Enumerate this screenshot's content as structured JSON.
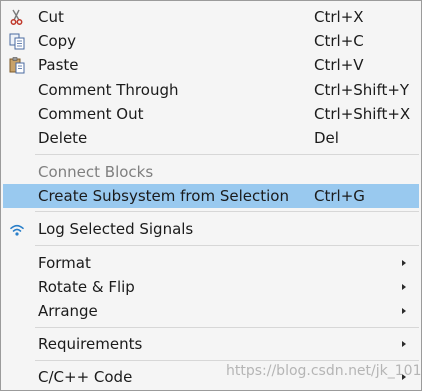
{
  "menu": {
    "items": [
      {
        "label": "Cut",
        "shortcut": "Ctrl+X",
        "icon": "scissors-icon"
      },
      {
        "label": "Copy",
        "shortcut": "Ctrl+C",
        "icon": "copy-icon"
      },
      {
        "label": "Paste",
        "shortcut": "Ctrl+V",
        "icon": "paste-icon"
      },
      {
        "label": "Comment Through",
        "shortcut": "Ctrl+Shift+Y"
      },
      {
        "label": "Comment Out",
        "shortcut": "Ctrl+Shift+X"
      },
      {
        "label": "Delete",
        "shortcut": "Del"
      },
      {
        "label": "Connect Blocks",
        "disabled": true
      },
      {
        "label": "Create Subsystem from Selection",
        "shortcut": "Ctrl+G",
        "highlighted": true
      },
      {
        "label": "Log Selected Signals",
        "icon": "wifi-signal-icon"
      },
      {
        "label": "Format",
        "submenu": true
      },
      {
        "label": "Rotate & Flip",
        "submenu": true
      },
      {
        "label": "Arrange",
        "submenu": true
      },
      {
        "label": "Requirements",
        "submenu": true
      },
      {
        "label": "C/C++ Code",
        "submenu": true
      }
    ]
  },
  "watermark": "https://blog.csdn.net/jk_101",
  "colors": {
    "highlight": "#99c9ef",
    "background": "#f5f5f5",
    "disabled_text": "#7f7f7f"
  }
}
